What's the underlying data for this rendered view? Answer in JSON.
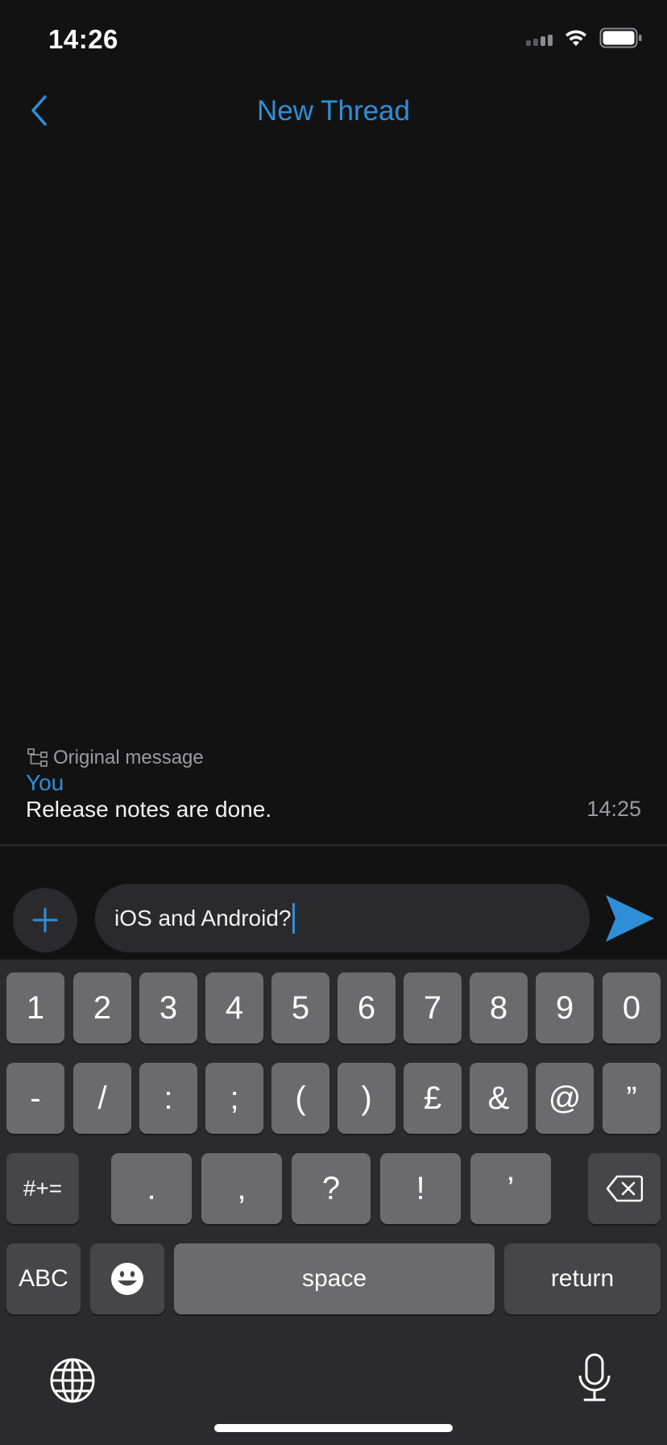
{
  "status_bar": {
    "time": "14:26"
  },
  "nav": {
    "title": "New Thread",
    "back_icon": "chevron-left-icon"
  },
  "original_message": {
    "label": "Original message",
    "sender": "You",
    "text": "Release notes are done.",
    "time": "14:25"
  },
  "composer": {
    "input_value": "iOS and Android?",
    "plus_icon": "plus-icon",
    "send_icon": "send-icon"
  },
  "keyboard": {
    "row1": [
      "1",
      "2",
      "3",
      "4",
      "5",
      "6",
      "7",
      "8",
      "9",
      "0"
    ],
    "row2": [
      "-",
      "/",
      ":",
      ";",
      "(",
      ")",
      "£",
      "&",
      "@",
      "”"
    ],
    "row3": {
      "symbols": "#+=",
      "keys": [
        ".",
        ",",
        "?",
        "!",
        "’"
      ]
    },
    "row4": {
      "abc": "ABC",
      "space": "space",
      "return": "return"
    }
  },
  "colors": {
    "accent": "#2f8fd6",
    "background": "#121213",
    "key": "#6b6b6e",
    "key_dark": "#464649"
  }
}
